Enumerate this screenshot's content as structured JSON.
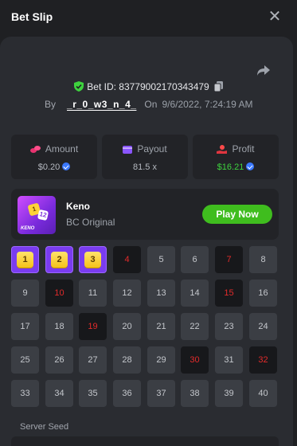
{
  "header": {
    "title": "Bet Slip",
    "close_icon": "close-icon"
  },
  "bet": {
    "id_label": "Bet ID: 83779002170343479",
    "by_label": "By",
    "username": "_r_0_w3_n_4_",
    "on_label": "On",
    "datetime": "9/6/2022, 7:24:19 AM"
  },
  "stats": {
    "amount": {
      "label": "Amount",
      "value": "$0.20",
      "icon": "coins-icon"
    },
    "payout": {
      "label": "Payout",
      "value": "81.5 x",
      "icon": "wallet-icon"
    },
    "profit": {
      "label": "Profit",
      "value": "$16.21",
      "icon": "money-hand-icon"
    }
  },
  "game": {
    "name": "Keno",
    "provider": "BC Original",
    "play_label": "Play Now",
    "thumb_text": "KENO",
    "thumb_die_1": "1",
    "thumb_die_2": "12"
  },
  "keno": {
    "numbers": [
      1,
      2,
      3,
      4,
      5,
      6,
      7,
      8,
      9,
      10,
      11,
      12,
      13,
      14,
      15,
      16,
      17,
      18,
      19,
      20,
      21,
      22,
      23,
      24,
      25,
      26,
      27,
      28,
      29,
      30,
      31,
      32,
      33,
      34,
      35,
      36,
      37,
      38,
      39,
      40
    ],
    "hits": [
      1,
      2,
      3
    ],
    "drawn": [
      4,
      7,
      10,
      15,
      19,
      30,
      32
    ]
  },
  "server_seed": {
    "label": "Server Seed"
  },
  "colors": {
    "accent_green": "#3fbd1e",
    "hit_purple": "#7a3cf0",
    "drawn_red": "#e22b2b",
    "panel": "#2a2c31"
  }
}
